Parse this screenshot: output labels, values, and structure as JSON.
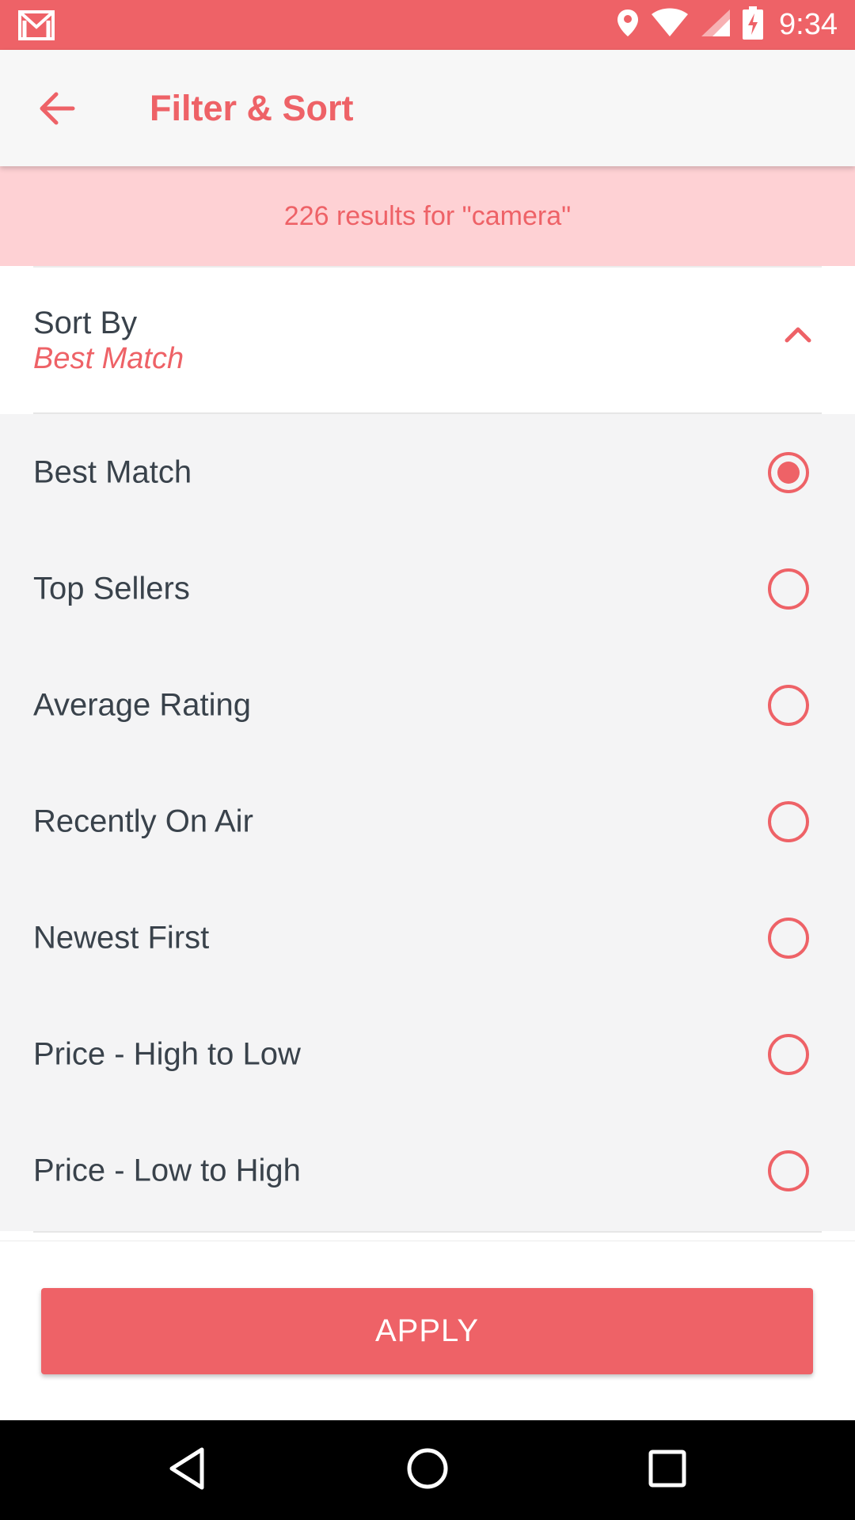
{
  "status_bar": {
    "time": "9:34",
    "icons": [
      "gmail-icon",
      "location-icon",
      "wifi-icon",
      "signal-icon",
      "battery-charging-icon"
    ],
    "color": "#ee6267"
  },
  "app_bar": {
    "back_icon": "arrow-back-icon",
    "title": "Filter & Sort"
  },
  "results_banner": {
    "text": "226 results for \"camera\""
  },
  "sort": {
    "title": "Sort By",
    "selected": "Best Match",
    "collapse_icon": "chevron-up-icon",
    "options": [
      {
        "label": "Best Match",
        "checked": true
      },
      {
        "label": "Top Sellers",
        "checked": false
      },
      {
        "label": "Average Rating",
        "checked": false
      },
      {
        "label": "Recently On Air",
        "checked": false
      },
      {
        "label": "Newest First",
        "checked": false
      },
      {
        "label": "Price - High to Low",
        "checked": false
      },
      {
        "label": "Price - Low to High",
        "checked": false
      }
    ]
  },
  "footer": {
    "apply_label": "APPLY"
  },
  "nav_bar": {
    "icons": [
      "nav-back-icon",
      "nav-home-icon",
      "nav-recents-icon"
    ]
  },
  "colors": {
    "accent": "#ee6267",
    "banner_bg": "#fed1d4",
    "text_dark": "#39424b",
    "list_bg": "#f4f4f5"
  }
}
